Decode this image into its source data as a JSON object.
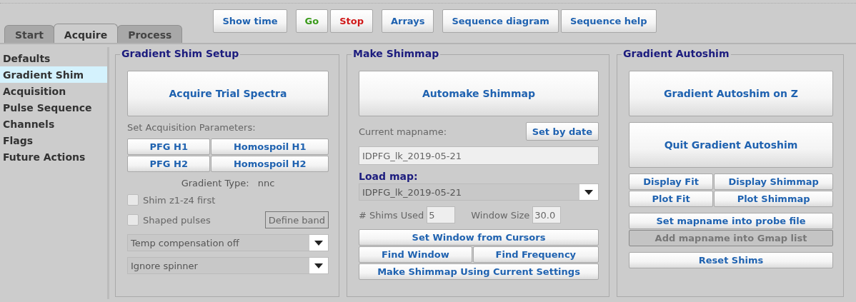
{
  "tabs": [
    {
      "label": "Start",
      "selected": false
    },
    {
      "label": "Acquire",
      "selected": true
    },
    {
      "label": "Process",
      "selected": false
    }
  ],
  "toolbar": [
    [
      {
        "label": "Show time",
        "color": "#1f62b0"
      }
    ],
    [
      {
        "label": "Go",
        "color": "#3a9a1a"
      },
      {
        "label": "Stop",
        "color": "#d01818"
      }
    ],
    [
      {
        "label": "Arrays",
        "color": "#1f62b0"
      }
    ],
    [
      {
        "label": "Sequence diagram",
        "color": "#1f62b0"
      },
      {
        "label": "Sequence help",
        "color": "#1f62b0"
      }
    ]
  ],
  "sidebar": {
    "items": [
      {
        "label": "Defaults",
        "selected": false
      },
      {
        "label": "Gradient Shim",
        "selected": true
      },
      {
        "label": "Acquisition",
        "selected": false
      },
      {
        "label": "Pulse Sequence",
        "selected": false
      },
      {
        "label": "Channels",
        "selected": false
      },
      {
        "label": "Flags",
        "selected": false
      },
      {
        "label": "Future Actions",
        "selected": false
      }
    ]
  },
  "panels": [
    {
      "title": "Gradient Shim Setup",
      "controls": [
        {
          "kind": "big_button",
          "label": "Acquire Trial Spectra"
        },
        {
          "kind": "label",
          "text": "Set Acquisition Parameters:"
        },
        {
          "kind": "button_grid",
          "rows": [
            [
              {
                "label": "PFG H1",
                "disabled": false
              },
              {
                "label": "Homospoil H1",
                "disabled": false
              }
            ],
            [
              {
                "label": "PFG H2",
                "disabled": false
              },
              {
                "label": "Homospoil H2",
                "disabled": false
              }
            ]
          ]
        },
        {
          "kind": "info",
          "label": "Gradient Type:",
          "value": "nnc"
        },
        {
          "kind": "checkbox",
          "label": "Shim z1-z4 first",
          "checked": false
        },
        {
          "kind": "checkbox",
          "label": "Shaped pulses",
          "checked": false,
          "button": "Define band"
        },
        {
          "kind": "dropdown",
          "value": "Temp compensation off"
        },
        {
          "kind": "dropdown",
          "value": "Ignore spinner"
        }
      ]
    },
    {
      "title": "Make Shimmap",
      "controls": [
        {
          "kind": "big_button",
          "label": "Automake Shimmap"
        },
        {
          "kind": "label",
          "text": "Current mapname:",
          "button": "Set by date"
        },
        {
          "kind": "text_field",
          "value": "IDPFG_lk_2019-05-21"
        },
        {
          "kind": "heading",
          "text": "Load map:"
        },
        {
          "kind": "dropdown",
          "value": "IDPFG_lk_2019-05-21"
        },
        {
          "kind": "field_pair",
          "fields": [
            {
              "label": "# Shims Used",
              "value": "5"
            },
            {
              "label": "Window Size",
              "value": "30.0"
            }
          ]
        },
        {
          "kind": "button_grid",
          "rows": [
            [
              {
                "label": "Set Window from Cursors",
                "disabled": false
              }
            ],
            [
              {
                "label": "Find Window",
                "disabled": false
              },
              {
                "label": "Find Frequency",
                "disabled": false
              }
            ],
            [
              {
                "label": "Make Shimmap Using Current Settings",
                "disabled": false
              }
            ]
          ]
        }
      ]
    },
    {
      "title": "Gradient Autoshim",
      "controls": [
        {
          "kind": "big_button",
          "label": "Gradient Autoshim on Z"
        },
        {
          "kind": "big_button",
          "label": "Quit Gradient Autoshim"
        },
        {
          "kind": "button_grid",
          "rows": [
            [
              {
                "label": "Display Fit",
                "disabled": false
              },
              {
                "label": "Display Shimmap",
                "disabled": false
              }
            ],
            [
              {
                "label": "Plot Fit",
                "disabled": false
              },
              {
                "label": "Plot Shimmap",
                "disabled": false
              }
            ]
          ]
        },
        {
          "kind": "button_grid",
          "rows": [
            [
              {
                "label": "Set mapname into probe file",
                "disabled": false
              }
            ],
            [
              {
                "label": "Add mapname into Gmap list",
                "disabled": true
              }
            ]
          ]
        },
        {
          "kind": "button_grid",
          "rows": [
            [
              {
                "label": "Reset Shims",
                "disabled": false
              }
            ]
          ]
        }
      ]
    }
  ]
}
